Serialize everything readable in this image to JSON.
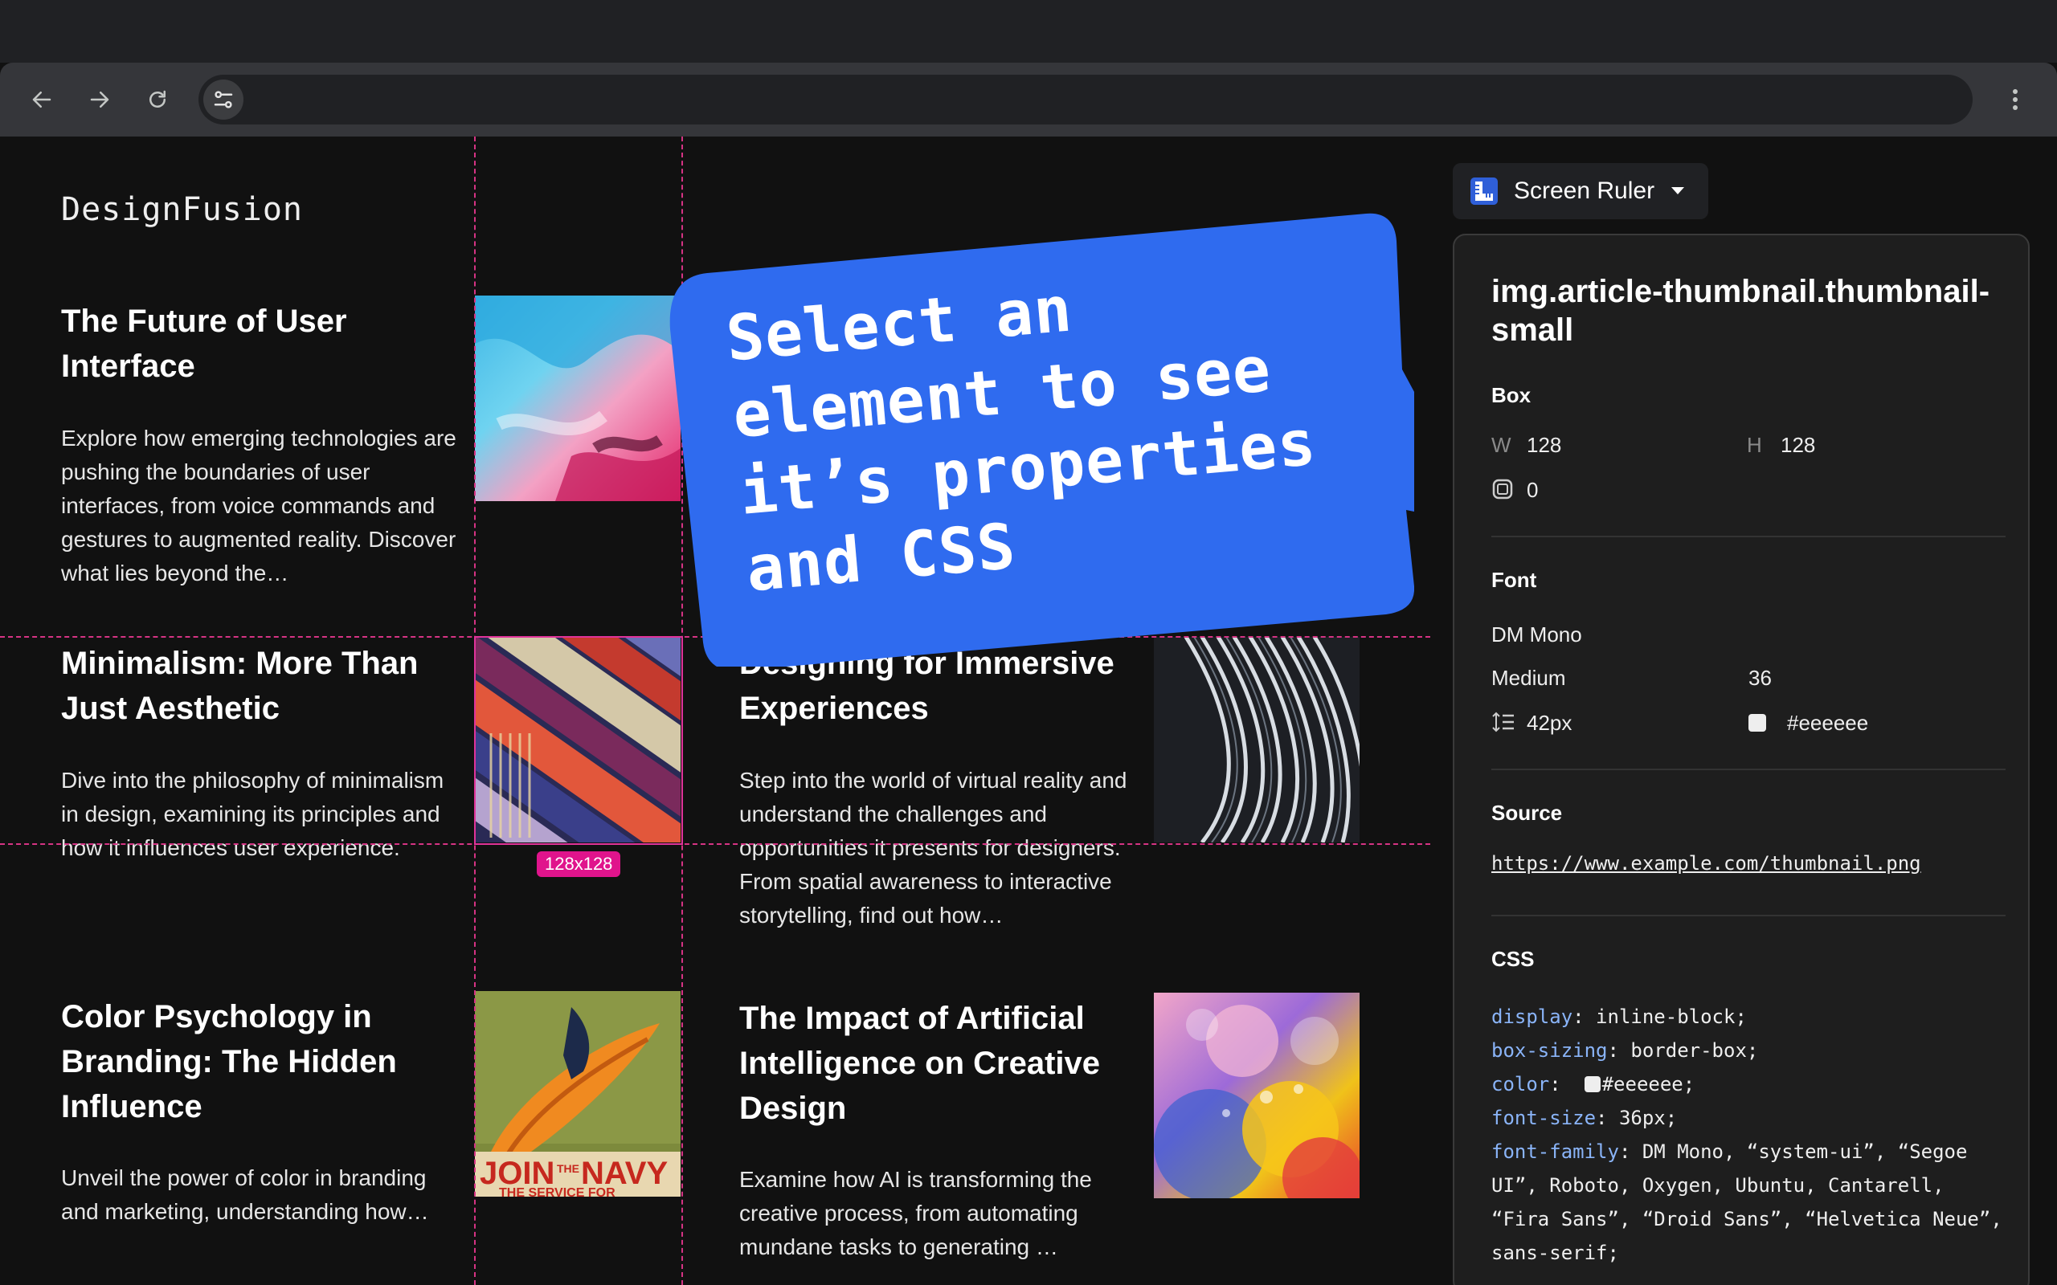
{
  "browser": {
    "address_text": ""
  },
  "site": {
    "logo": "DesignFusion"
  },
  "articles": [
    {
      "title": "The Future of User Interface",
      "desc": "Explore how emerging technologies are pushing the boundaries of user interfaces, from voice commands and gestures to augmented reality. Discover what lies beyond the…"
    },
    {
      "title": "Minimalism: More Than Just Aesthetic",
      "desc": "Dive into the philosophy of minimalism in design, examining its principles and how it influences user experience."
    },
    {
      "title": "Designing for Immersive Experiences",
      "desc": "Step into the world of virtual reality and understand the challenges and opportunities it presents for designers. From spatial awareness to interactive storytelling, find out how…"
    },
    {
      "title": "Color Psychology in Branding: The Hidden Influence",
      "desc": "Unveil the power of color in branding and marketing, understanding how…"
    },
    {
      "title": "The Impact of Artificial Intelligence on Creative Design",
      "desc": "Examine how AI is transforming the creative process, from automating mundane tasks to generating …"
    }
  ],
  "thumbnails": {
    "poster_text_1": "JOIN",
    "poster_text_2": "THE",
    "poster_text_3": "NAVY",
    "poster_text_4": "THE SERVICE FOR"
  },
  "overlay": {
    "size_badge": "128x128",
    "bubble_text": "Select an element to see it’s properties and CSS",
    "bubble_color": "#2f6bef",
    "guide_color": "#d63384"
  },
  "extension": {
    "name": "Screen Ruler",
    "selector": "img.article-thumbnail.thumbnail-small",
    "box": {
      "title": "Box",
      "w_label": "W",
      "w": "128",
      "h_label": "H",
      "h": "128",
      "radius": "0"
    },
    "font": {
      "title": "Font",
      "family": "DM Mono",
      "weight": "Medium",
      "size": "36",
      "line_height": "42px",
      "color": "#eeeeee"
    },
    "source": {
      "title": "Source",
      "url": "https://www.example.com/thumbnail.png"
    },
    "css": {
      "title": "CSS",
      "lines": [
        {
          "prop": "display",
          "value": " inline-block;"
        },
        {
          "prop": "box-sizing",
          "value": " border-box;"
        },
        {
          "prop": "color",
          "value": "#eeeeee;"
        },
        {
          "prop": "font-size",
          "value": " 36px;"
        },
        {
          "prop": "font-family",
          "value": " DM Mono, “system-ui”, “Segoe UI”, Roboto, Oxygen, Ubuntu, Cantarell, “Fira Sans”, “Droid Sans”, “Helvetica Neue”, sans-serif;"
        }
      ]
    }
  }
}
